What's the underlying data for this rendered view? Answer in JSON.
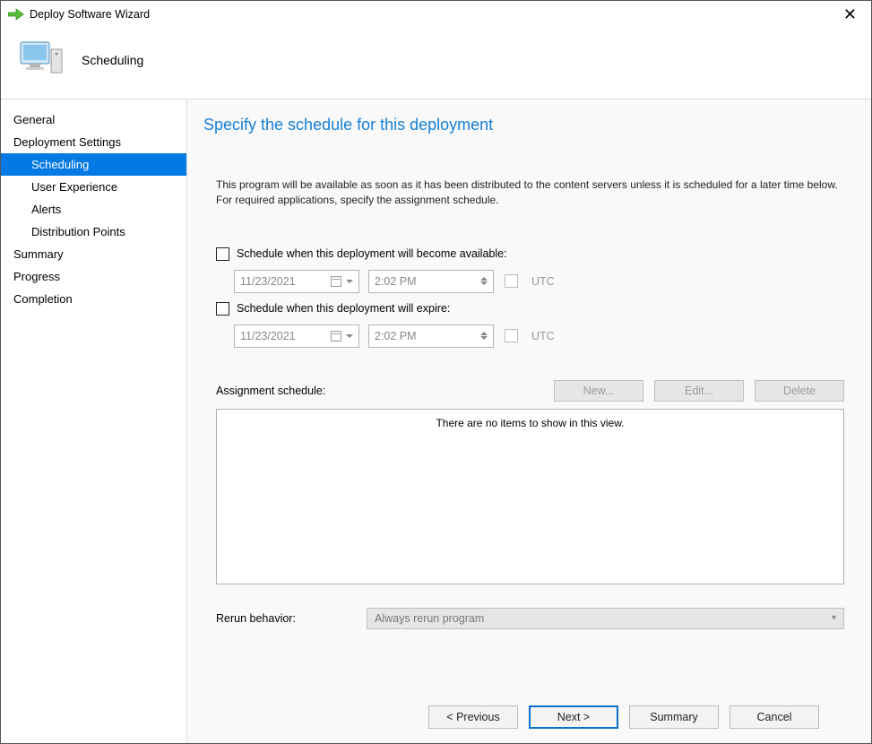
{
  "window": {
    "title": "Deploy Software Wizard"
  },
  "header": {
    "page_name": "Scheduling"
  },
  "sidebar": {
    "items": [
      {
        "label": "General",
        "indent": false,
        "selected": false
      },
      {
        "label": "Deployment Settings",
        "indent": false,
        "selected": false
      },
      {
        "label": "Scheduling",
        "indent": true,
        "selected": true
      },
      {
        "label": "User Experience",
        "indent": true,
        "selected": false
      },
      {
        "label": "Alerts",
        "indent": true,
        "selected": false
      },
      {
        "label": "Distribution Points",
        "indent": true,
        "selected": false
      },
      {
        "label": "Summary",
        "indent": false,
        "selected": false
      },
      {
        "label": "Progress",
        "indent": false,
        "selected": false
      },
      {
        "label": "Completion",
        "indent": false,
        "selected": false
      }
    ]
  },
  "content": {
    "heading": "Specify the schedule for this deployment",
    "description": "This program will be available as soon as it has been distributed to the content servers unless it is scheduled for a later time below. For required applications, specify the assignment schedule.",
    "available": {
      "checkbox_label": "Schedule when this deployment will become available:",
      "date": "11/23/2021",
      "time": "2:02 PM",
      "utc_label": "UTC"
    },
    "expire": {
      "checkbox_label": "Schedule when this deployment will expire:",
      "date": "11/23/2021",
      "time": "2:02 PM",
      "utc_label": "UTC"
    },
    "assignment": {
      "label": "Assignment schedule:",
      "new_btn": "New...",
      "edit_btn": "Edit...",
      "delete_btn": "Delete",
      "empty_text": "There are no items to show in this view."
    },
    "rerun": {
      "label": "Rerun behavior:",
      "value": "Always rerun program"
    }
  },
  "footer": {
    "previous": "< Previous",
    "next": "Next >",
    "summary": "Summary",
    "cancel": "Cancel"
  }
}
